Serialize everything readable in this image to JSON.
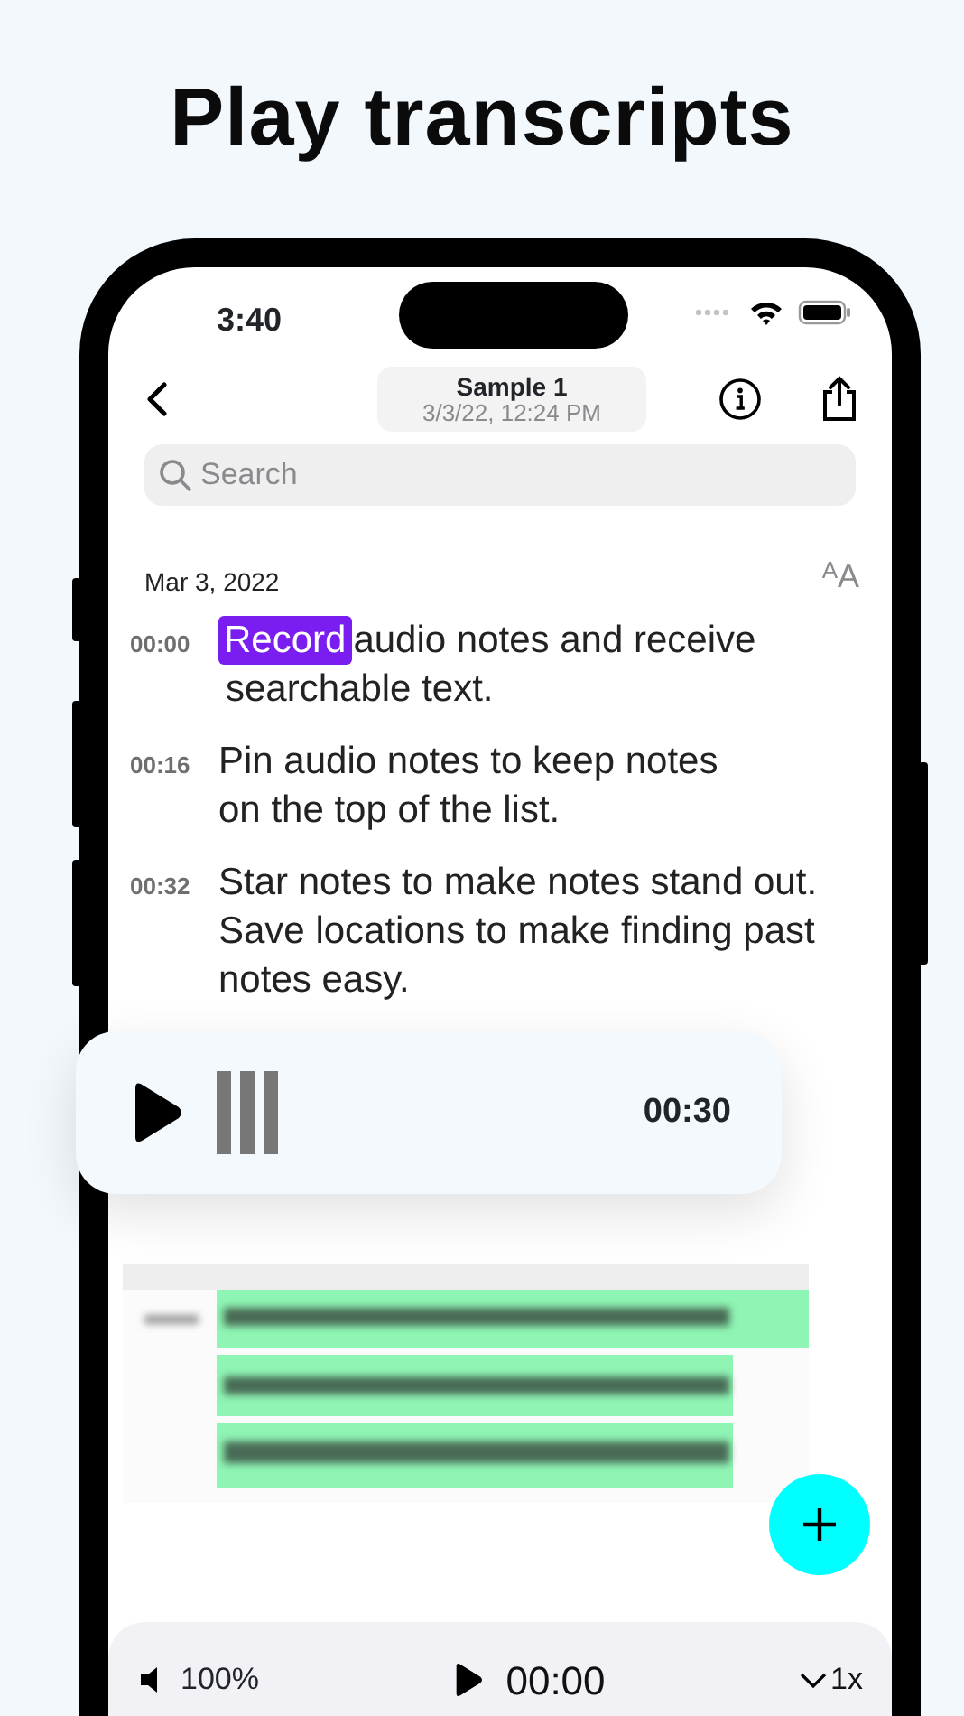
{
  "header": {
    "title": "Play transcripts"
  },
  "status_bar": {
    "time": "3:40"
  },
  "nav": {
    "title": "Sample 1",
    "subtitle": "3/3/22, 12:24 PM"
  },
  "search": {
    "placeholder": "Search"
  },
  "transcript": {
    "date": "Mar 3, 2022",
    "text_size": "AA",
    "segments": [
      {
        "time": "00:00",
        "highlight": "Record",
        "lines": [
          "audio notes and receive",
          "searchable text."
        ]
      },
      {
        "time": "00:16",
        "lines": [
          "Pin audio notes to keep notes",
          "on the top of the list."
        ]
      },
      {
        "time": "00:32",
        "lines": [
          "Star notes to make notes stand out.",
          "Save locations to make finding past",
          "notes easy."
        ]
      }
    ]
  },
  "player": {
    "playing": false,
    "time": "00:30"
  },
  "bottom_bar": {
    "volume": "100%",
    "playing": false,
    "time": "00:00",
    "speed": "1x"
  }
}
